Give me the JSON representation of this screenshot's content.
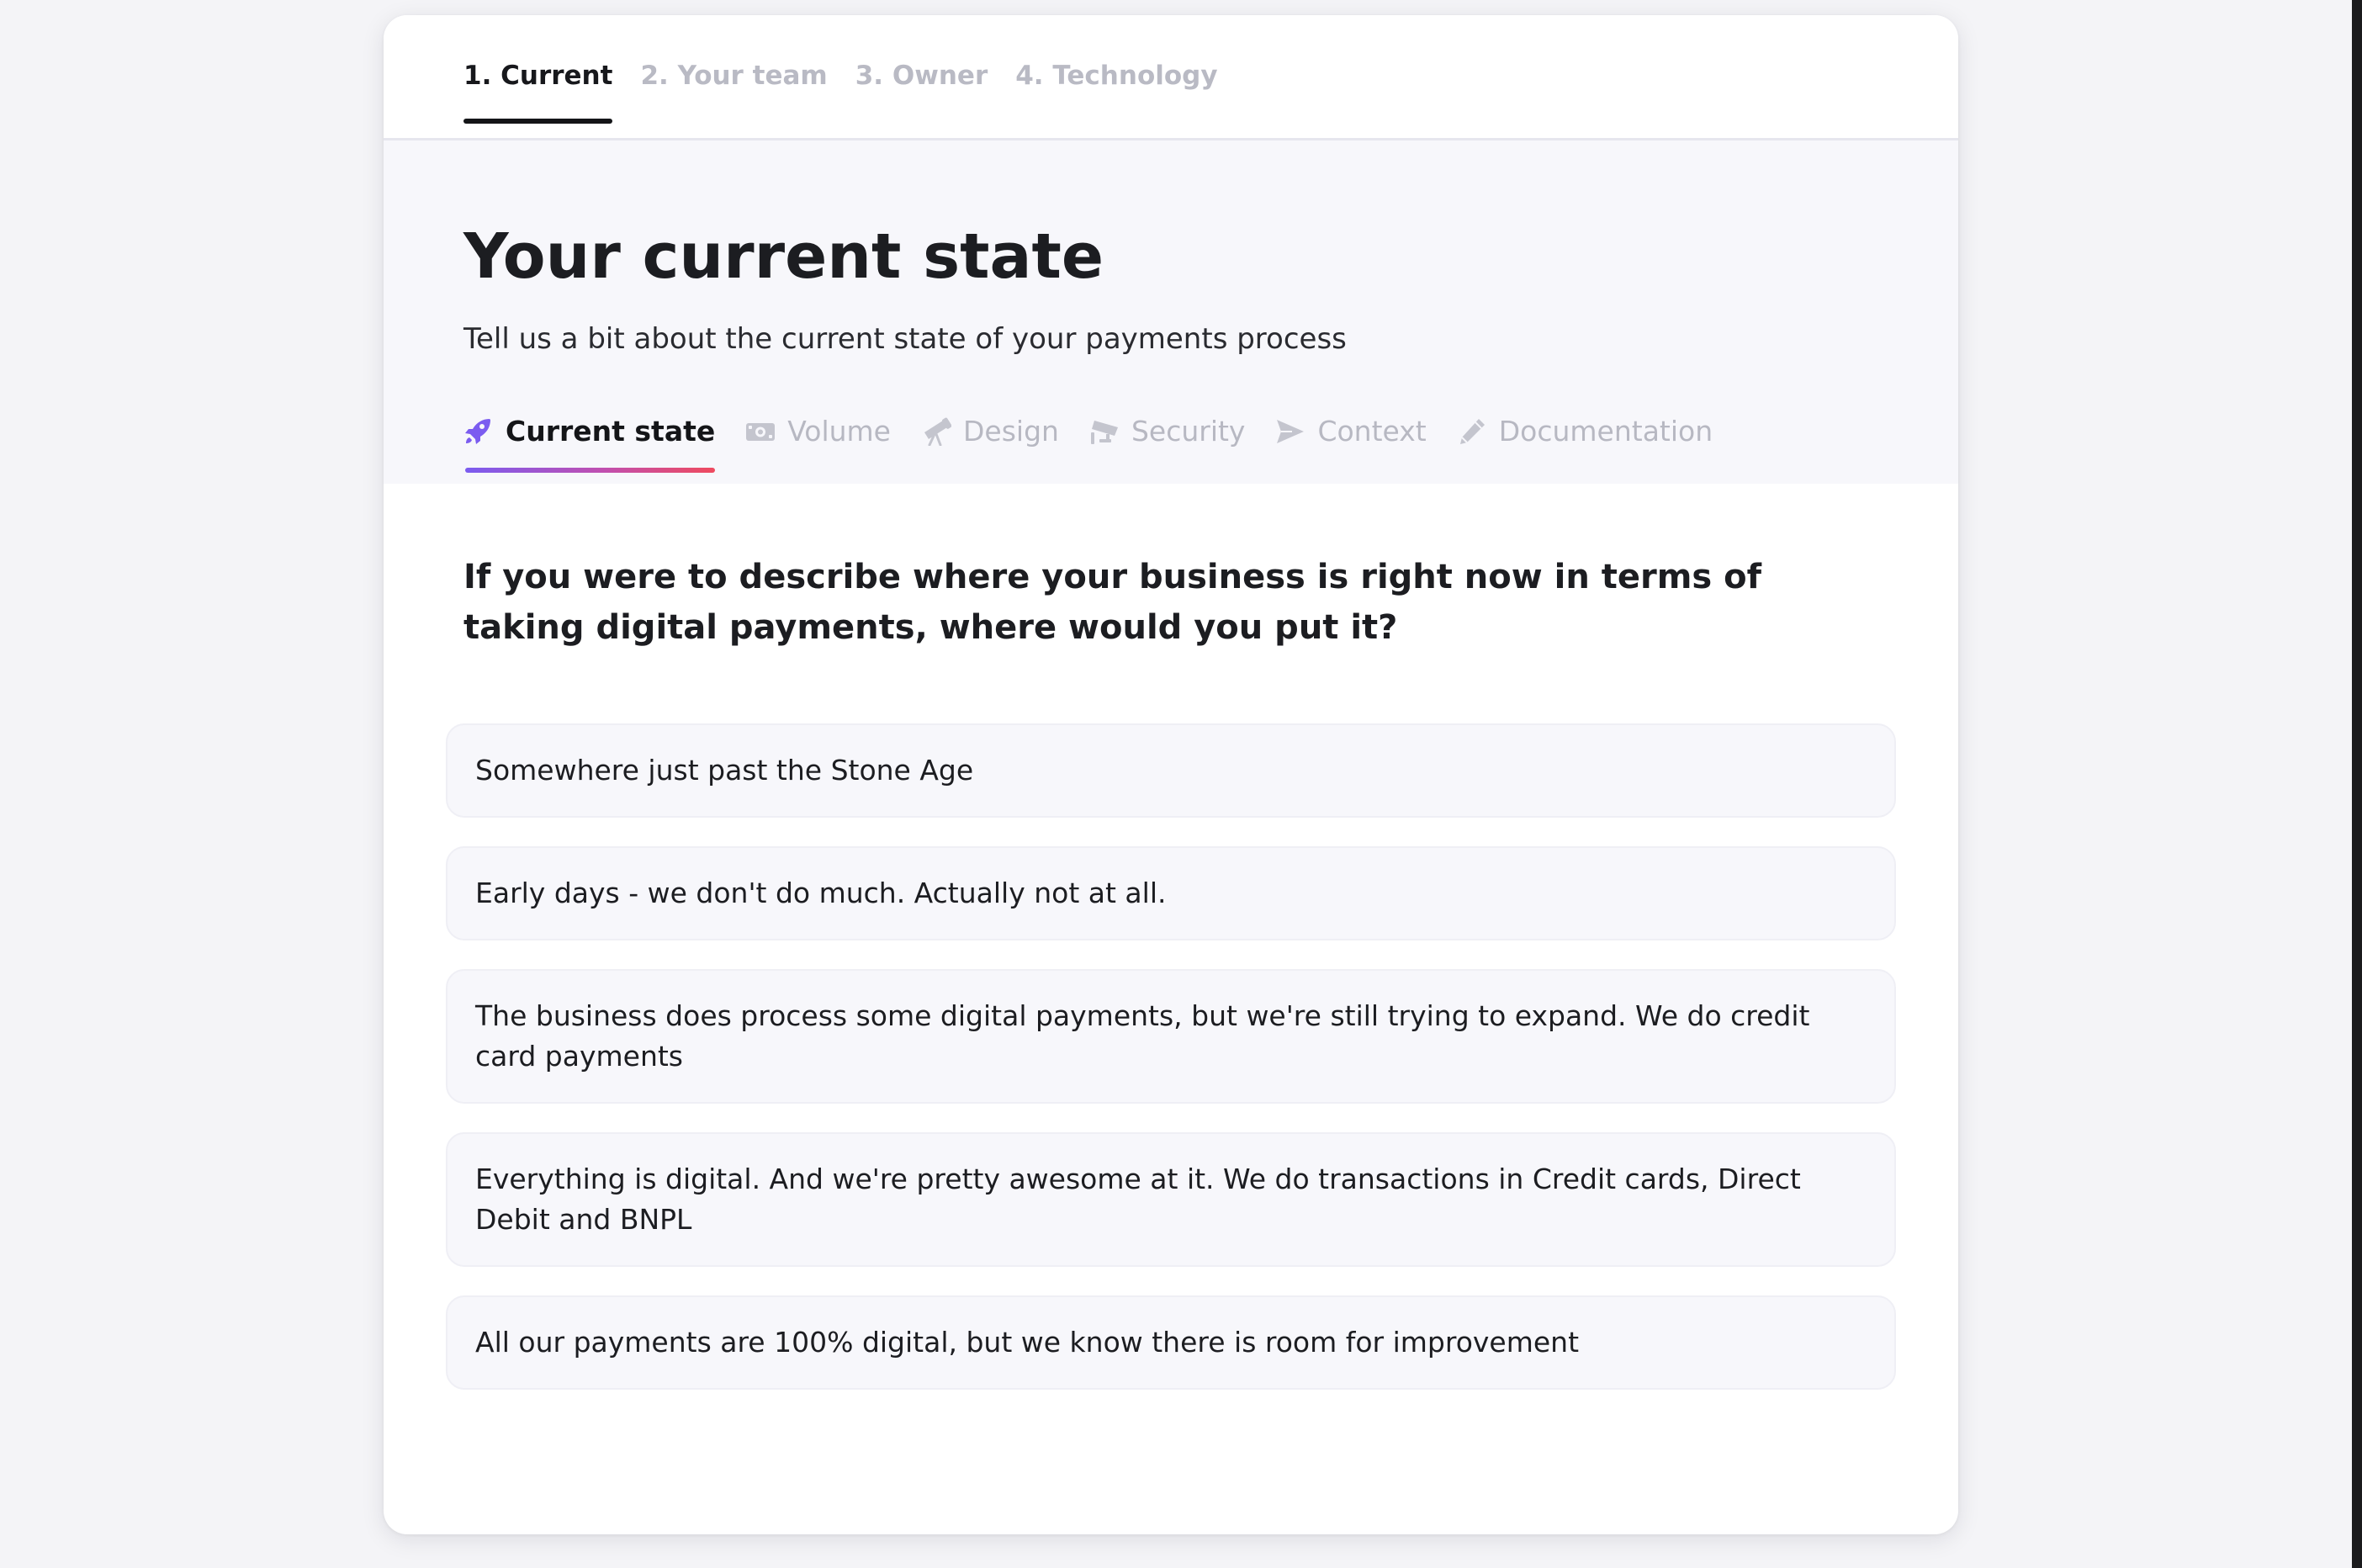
{
  "steps": [
    {
      "label": "1. Current",
      "active": true
    },
    {
      "label": "2. Your team",
      "active": false
    },
    {
      "label": "3. Owner",
      "active": false
    },
    {
      "label": "4. Technology",
      "active": false
    }
  ],
  "header": {
    "title": "Your current state",
    "subtitle": "Tell us a bit about the current state of your payments process"
  },
  "sub_tabs": [
    {
      "label": "Current state",
      "icon": "rocket-icon",
      "active": true
    },
    {
      "label": "Volume",
      "icon": "money-icon",
      "active": false
    },
    {
      "label": "Design",
      "icon": "telescope-icon",
      "active": false
    },
    {
      "label": "Security",
      "icon": "security-camera-icon",
      "active": false
    },
    {
      "label": "Context",
      "icon": "paper-plane-icon",
      "active": false
    },
    {
      "label": "Documentation",
      "icon": "pencil-icon",
      "active": false
    }
  ],
  "question": "If you were to describe where your business is right now in terms of taking digital payments, where would you put it?",
  "options": [
    "Somewhere just past the Stone Age",
    "Early days - we don't do much. Actually not at all.",
    "The business does process some digital payments, but we're still trying to expand. We do credit card payments",
    "Everything is digital. And we're pretty awesome at it. We do transactions in Credit cards, Direct Debit and BNPL",
    "All our payments are 100% digital, but we know there is room for improvement"
  ],
  "colors": {
    "accent_gradient_start": "#7b5cf0",
    "accent_gradient_end": "#ef4a5e",
    "active_icon": "#7b5cf0",
    "inactive_text": "#b7b8c2"
  }
}
